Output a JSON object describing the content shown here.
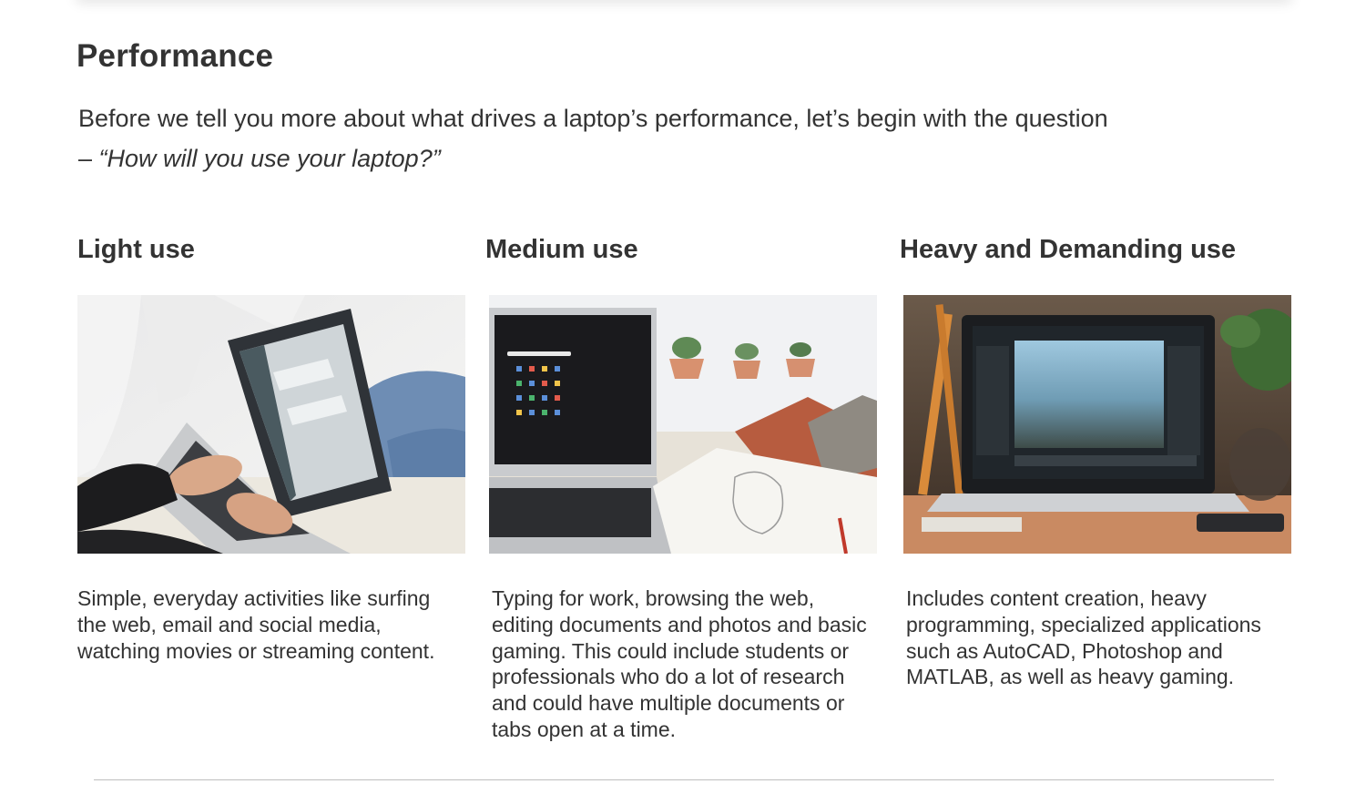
{
  "section": {
    "heading": "Performance",
    "intro_text": "Before we tell you more about what drives a laptop’s performance, let’s begin with the question",
    "intro_dash": "– ",
    "intro_question": "“How will you use your laptop?”"
  },
  "columns": [
    {
      "title": "Light use",
      "image_icon": "laptop-typing-photo",
      "description": "Simple, everyday activities like surfing the web, email and social media, watching movies or streaming content."
    },
    {
      "title": "Medium use",
      "image_icon": "laptop-desk-sketchbook-photo",
      "description": "Typing for work, browsing the web, editing documents and photos and basic gaming. This could include students or professionals who do a lot of research and could have multiple documents or tabs open at a time."
    },
    {
      "title": "Heavy and Demanding use",
      "image_icon": "laptop-photo-editing-photo",
      "description": "Includes content creation, heavy programming, specialized applications such as AutoCAD, Photoshop and MATLAB, as well as heavy gaming."
    }
  ]
}
